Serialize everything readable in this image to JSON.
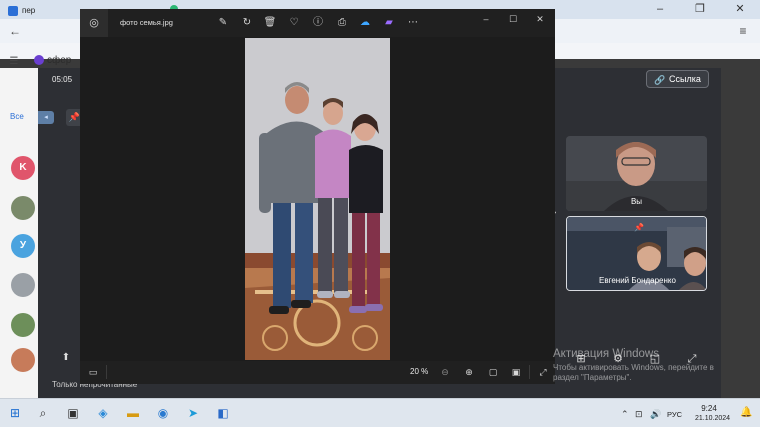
{
  "browser": {
    "tab1_label": "пер",
    "tab2_label": "",
    "address_text": "сфер"
  },
  "messenger": {
    "sidebar_avatars": [
      "K",
      "",
      "У",
      "",
      "",
      "",
      ""
    ],
    "sidebar_filter_label": "Все"
  },
  "call": {
    "time": "05:05",
    "link_button_label": "Ссылка",
    "footer_label": "Только непрочитанные",
    "participants": [
      {
        "name": "Вы"
      },
      {
        "name": "Евгений Бондаренко"
      }
    ]
  },
  "photos_app": {
    "filename": "фото семья.jpg",
    "toolbar_icons": [
      "edit-icon",
      "rotate-icon",
      "delete-icon",
      "favorite-icon",
      "info-icon",
      "print-icon",
      "onedrive-icon",
      "clipchamp-icon",
      "more-icon"
    ],
    "zoom": "20 %",
    "bottom_icons": [
      "filmstrip-icon",
      "zoom-out-icon",
      "zoom-in-icon",
      "fit-icon",
      "actual-size-icon",
      "fullscreen-icon"
    ]
  },
  "watermark": {
    "title": "Активация Windows",
    "text": "Чтобы активировать Windows, перейдите в раздел \"Параметры\"."
  },
  "taskbar": {
    "language": "РУС",
    "time": "9:24",
    "date": "21.10.2024"
  },
  "colors": {
    "photos_bg": "#1e1e1e",
    "call_bg": "#2d2f34",
    "taskbar_bg": "#dfe6ee"
  }
}
